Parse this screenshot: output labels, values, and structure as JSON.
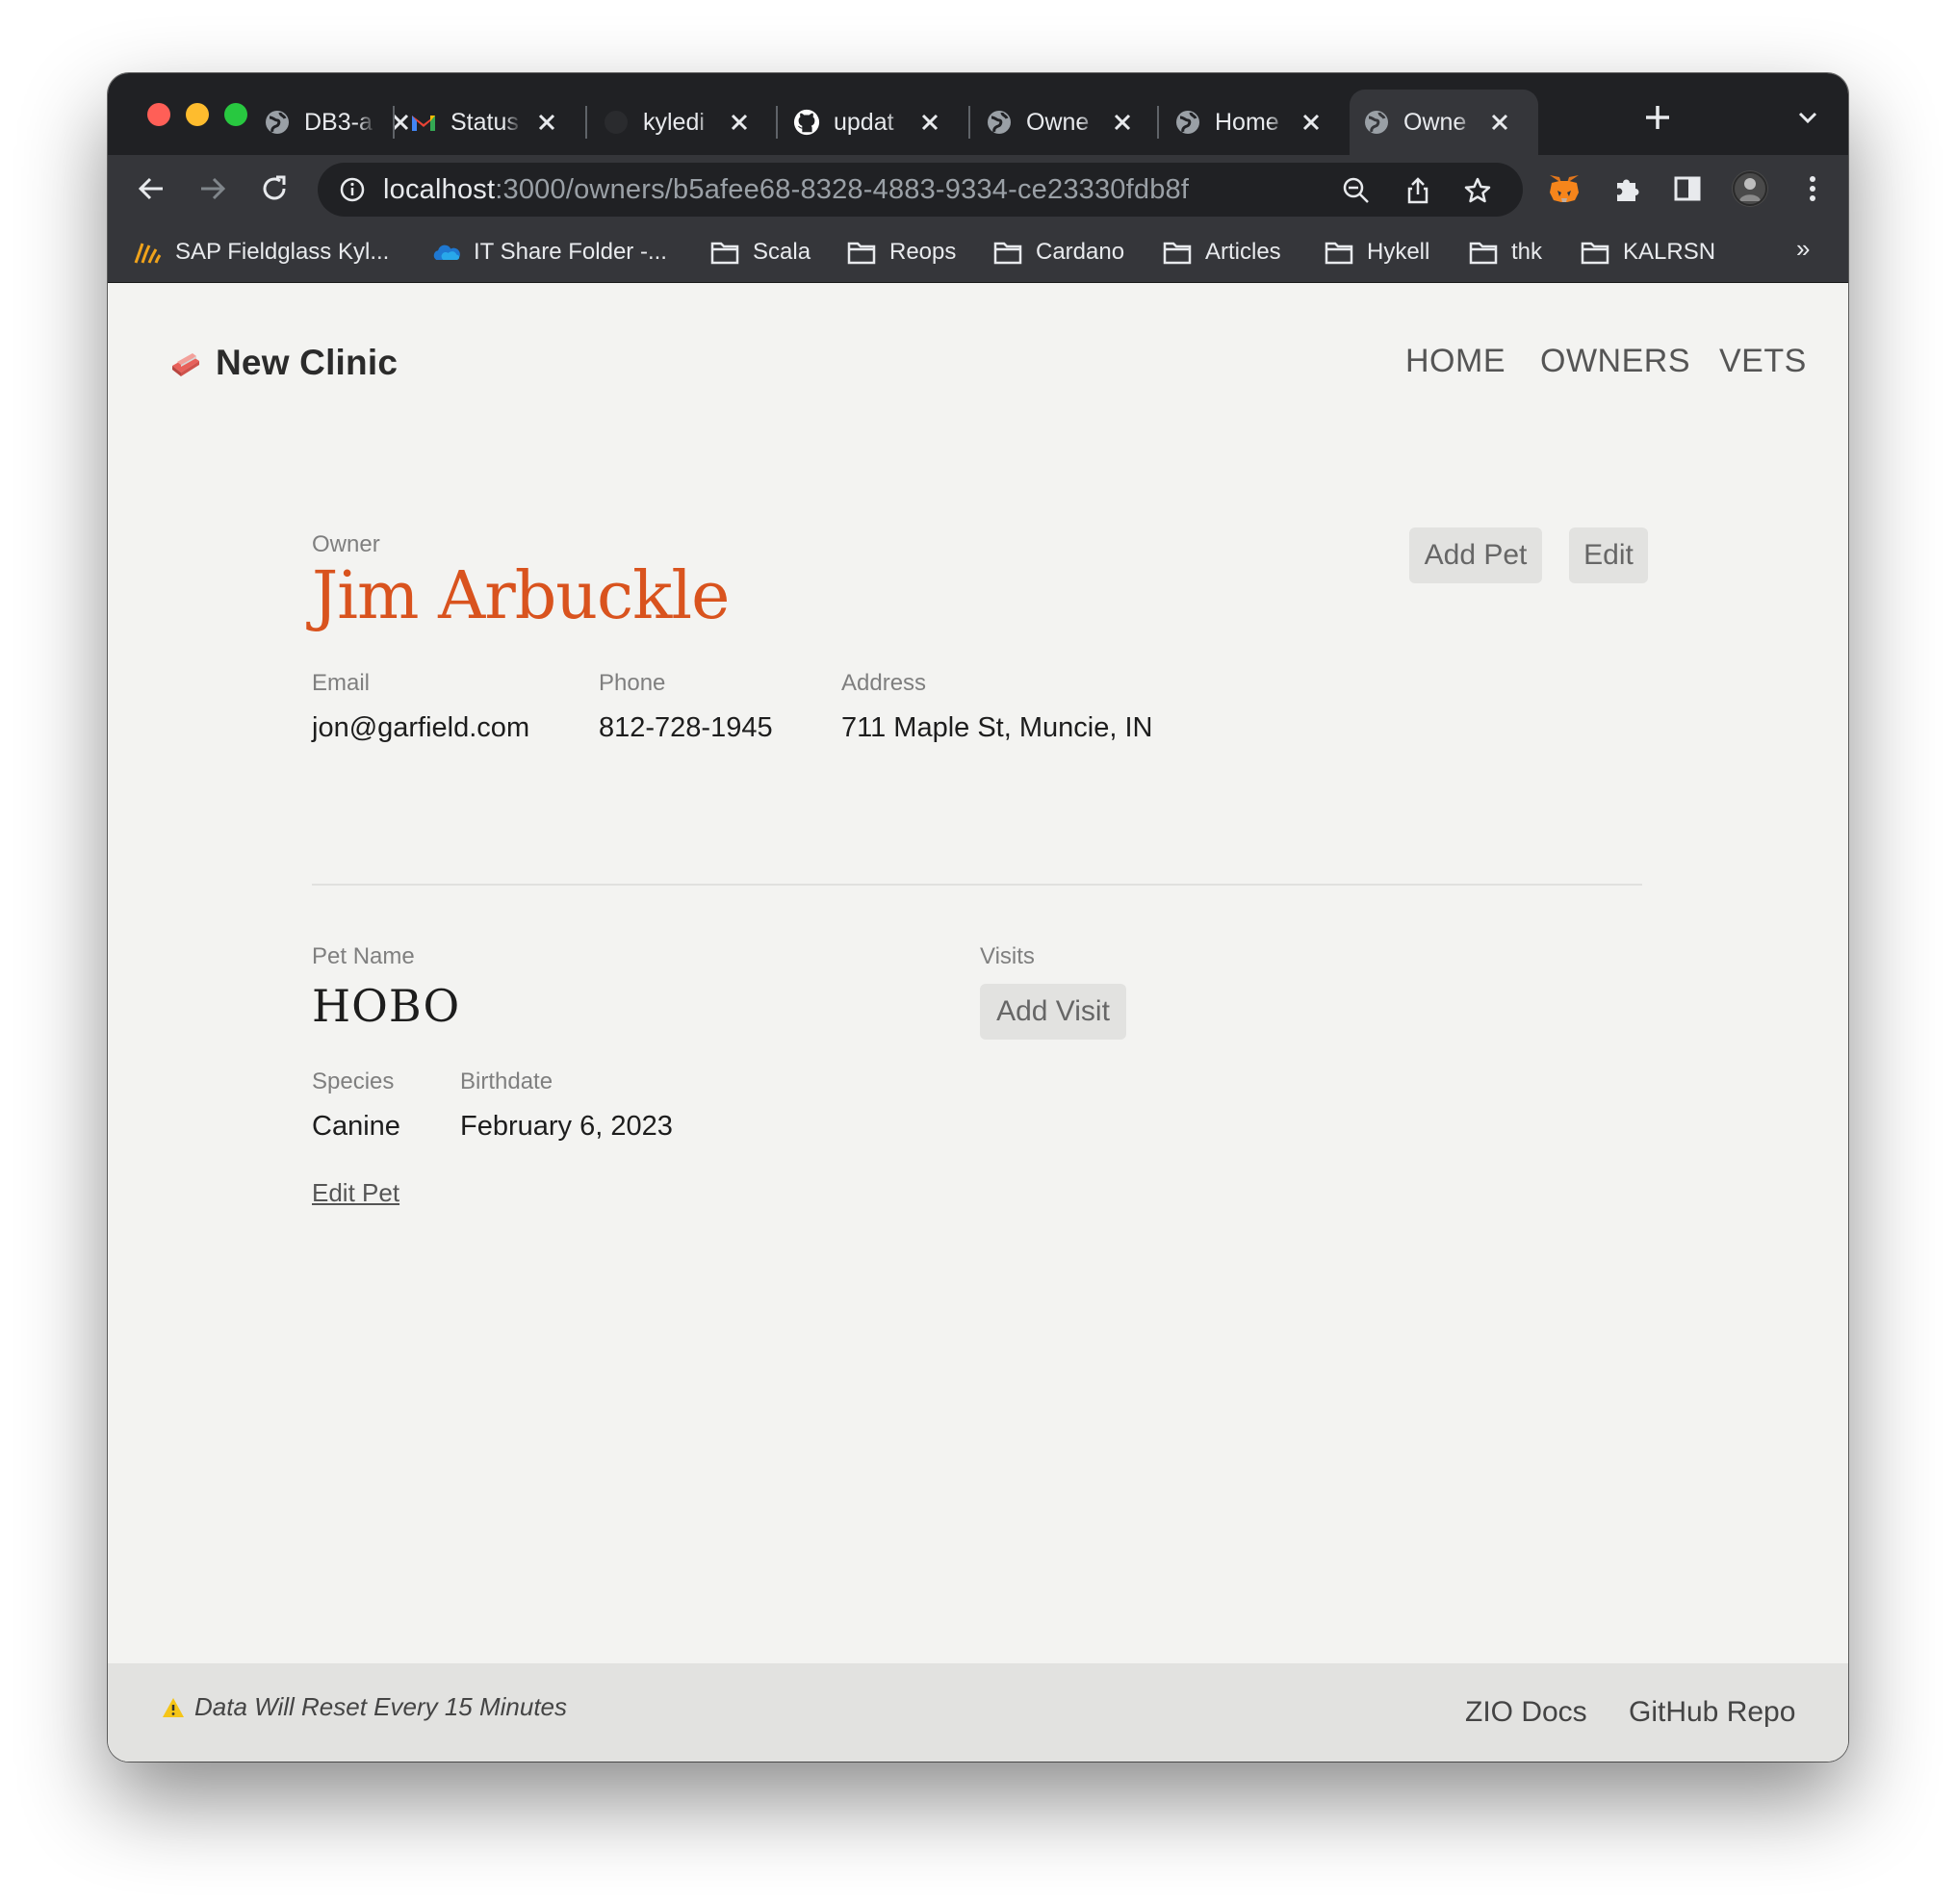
{
  "browser": {
    "tabs": [
      {
        "title": "DB3-a",
        "icon": "globe-icon"
      },
      {
        "title": "Status",
        "icon": "gmail-icon"
      },
      {
        "title": "kyledi",
        "icon": "github-icon"
      },
      {
        "title": "updat",
        "icon": "github-icon"
      },
      {
        "title": "Owne",
        "icon": "globe-icon"
      },
      {
        "title": "Home",
        "icon": "globe-icon"
      },
      {
        "title": "Owne",
        "icon": "globe-icon",
        "active": true
      }
    ],
    "url_host": "localhost",
    "url_path": ":3000/owners/b5afee68-8328-4883-9334-ce23330fdb8f",
    "bookmarks": [
      {
        "label": "SAP Fieldglass Kyl...",
        "icon": "fieldglass-icon"
      },
      {
        "label": "IT Share Folder -...",
        "icon": "onedrive-icon"
      },
      {
        "label": "Scala",
        "icon": "folder-icon"
      },
      {
        "label": "Reops",
        "icon": "folder-icon"
      },
      {
        "label": "Cardano",
        "icon": "folder-icon"
      },
      {
        "label": "Articles",
        "icon": "folder-icon"
      },
      {
        "label": "Hykell",
        "icon": "folder-icon"
      },
      {
        "label": "thk",
        "icon": "folder-icon"
      },
      {
        "label": "KALRSN",
        "icon": "folder-icon"
      }
    ],
    "bookmarks_more": "»"
  },
  "header": {
    "brand": "New Clinic",
    "nav": [
      "HOME",
      "OWNERS",
      "VETS"
    ]
  },
  "owner": {
    "section_label": "Owner",
    "name": "Jim Arbuckle",
    "add_pet_label": "Add Pet",
    "edit_label": "Edit",
    "email_label": "Email",
    "email": "jon@garfield.com",
    "phone_label": "Phone",
    "phone": "812-728-1945",
    "address_label": "Address",
    "address": "711 Maple St, Muncie, IN"
  },
  "pet": {
    "name_label": "Pet Name",
    "name": "HOBO",
    "species_label": "Species",
    "species": "Canine",
    "birthdate_label": "Birthdate",
    "birthdate": "February 6, 2023",
    "edit_label": "Edit Pet",
    "visits_label": "Visits",
    "add_visit_label": "Add Visit"
  },
  "footer": {
    "notice": "Data Will Reset Every 15 Minutes",
    "links": [
      "ZIO Docs",
      "GitHub Repo"
    ]
  },
  "colors": {
    "accent": "#d9531e",
    "page_bg": "#f3f3f1",
    "button_bg": "#e2e2e0"
  }
}
